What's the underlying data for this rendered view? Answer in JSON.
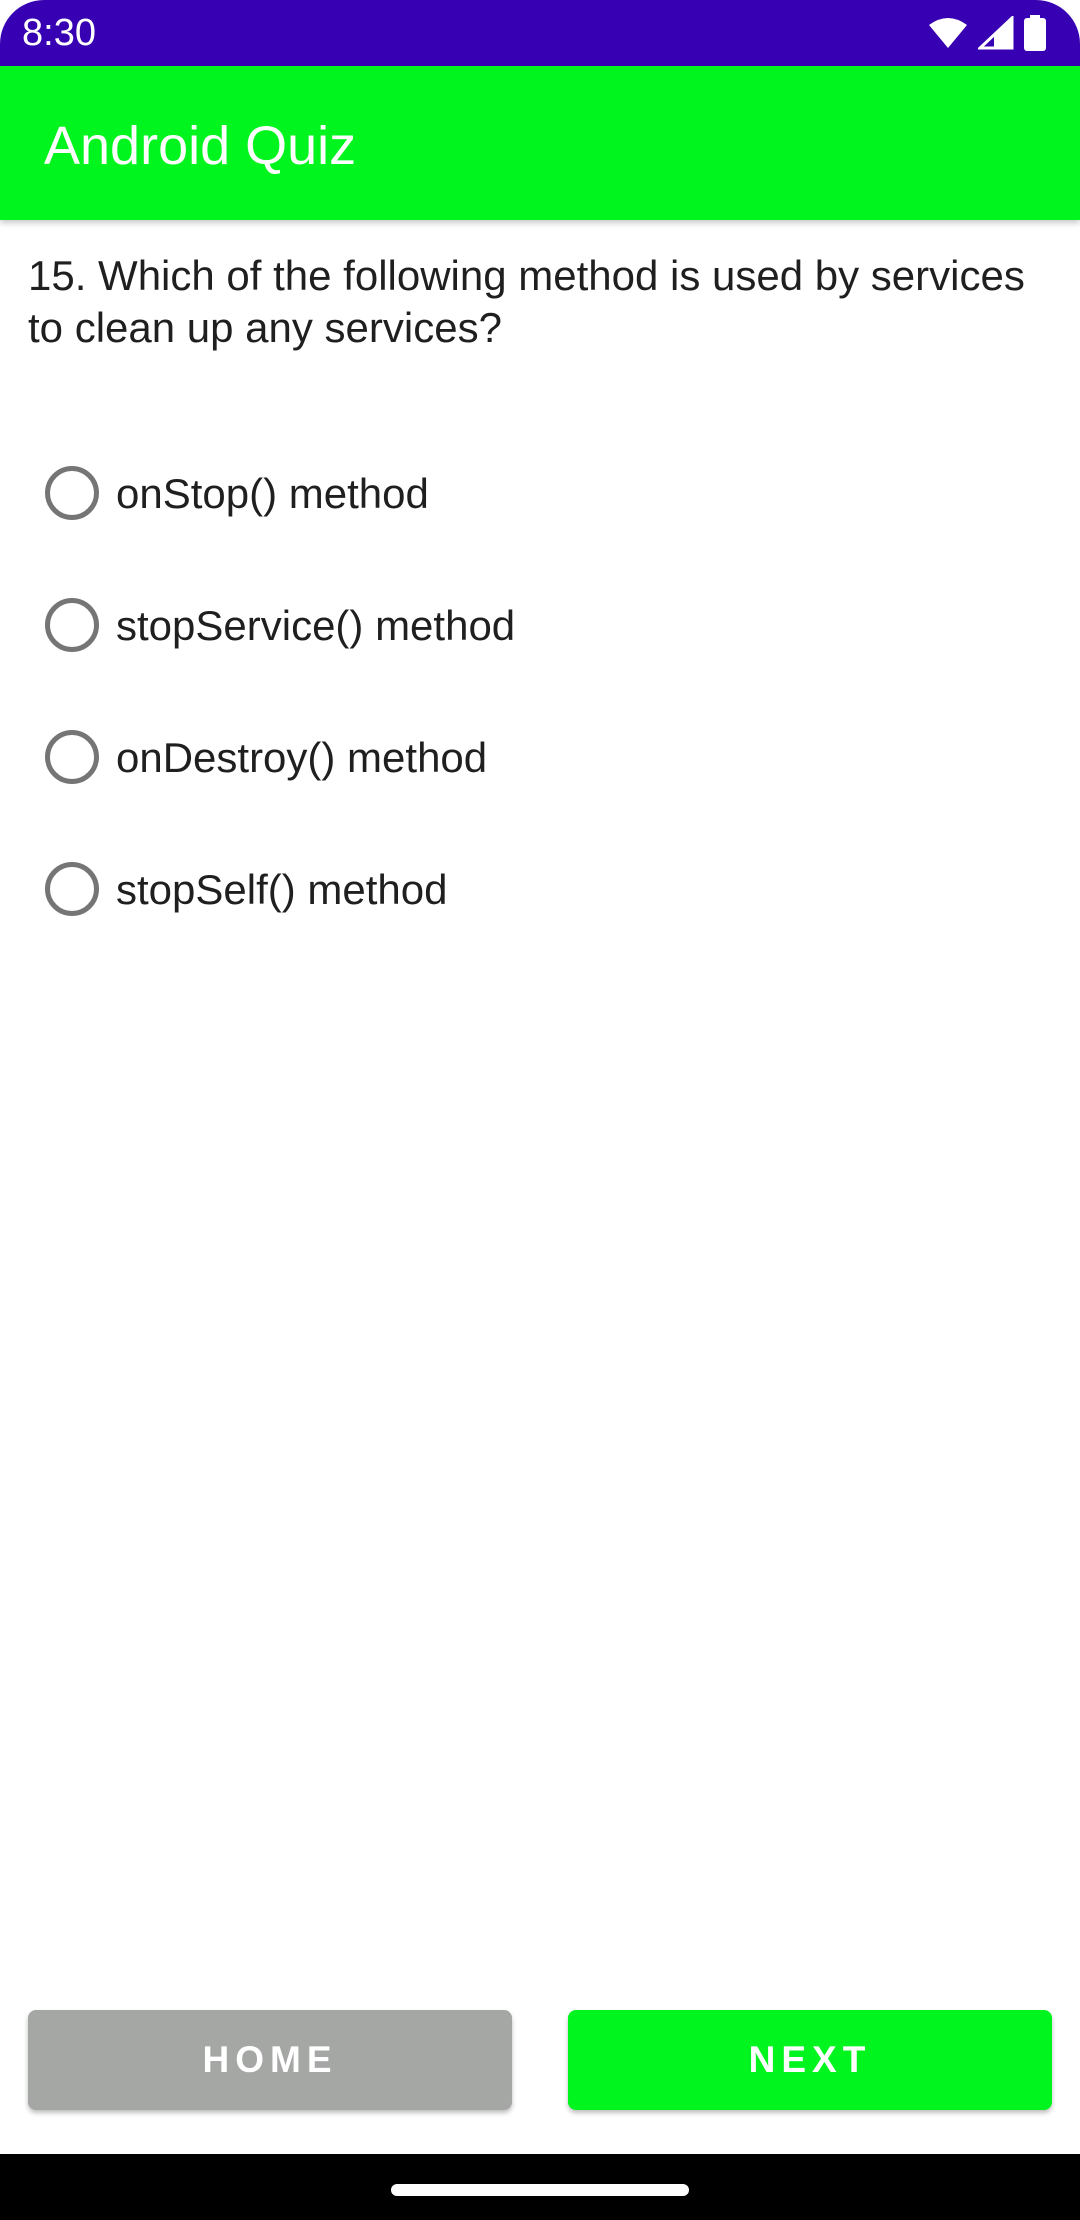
{
  "status_bar": {
    "time": "8:30",
    "icons": [
      "wifi-icon",
      "cellular-signal-icon",
      "battery-icon"
    ],
    "background": "#3700b3"
  },
  "app_bar": {
    "title": "Android Quiz",
    "background": "#00f41e"
  },
  "question": {
    "text": "15. Which of the following method is used by services to clean up any services?"
  },
  "options": [
    {
      "label": "onStop() method",
      "selected": false
    },
    {
      "label": "stopService() method",
      "selected": false
    },
    {
      "label": "onDestroy() method",
      "selected": false
    },
    {
      "label": "stopSelf() method",
      "selected": false
    }
  ],
  "buttons": {
    "home_label": "HOME",
    "next_label": "NEXT",
    "home_color": "#a5a7a5",
    "next_color": "#00f41e"
  },
  "nav_bar": {
    "icons": [
      "home-gesture-pill"
    ]
  }
}
